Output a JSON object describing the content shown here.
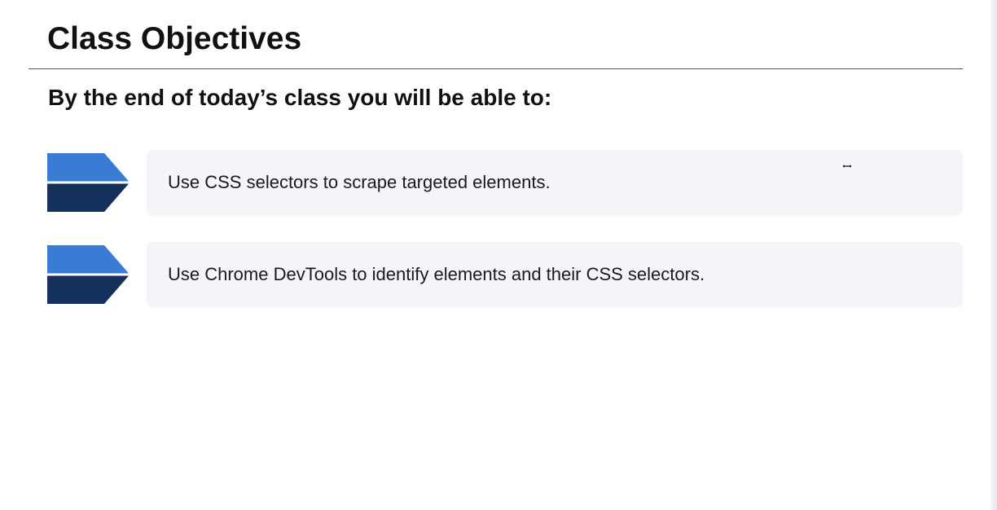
{
  "slide": {
    "title": "Class Objectives",
    "subtitle": "By the end of today’s class you will be able to:",
    "objectives": [
      {
        "text": "Use CSS selectors to scrape targeted elements."
      },
      {
        "text": "Use Chrome DevTools to identify elements and their CSS selectors."
      }
    ]
  },
  "colors": {
    "chevron_top": "#3a7bd5",
    "chevron_bottom": "#15305a",
    "card_background": "#f3f5f9"
  },
  "icons": {
    "objective_marker": "chevron-arrow-icon",
    "cursor": "resize-horizontal-cursor-icon"
  }
}
